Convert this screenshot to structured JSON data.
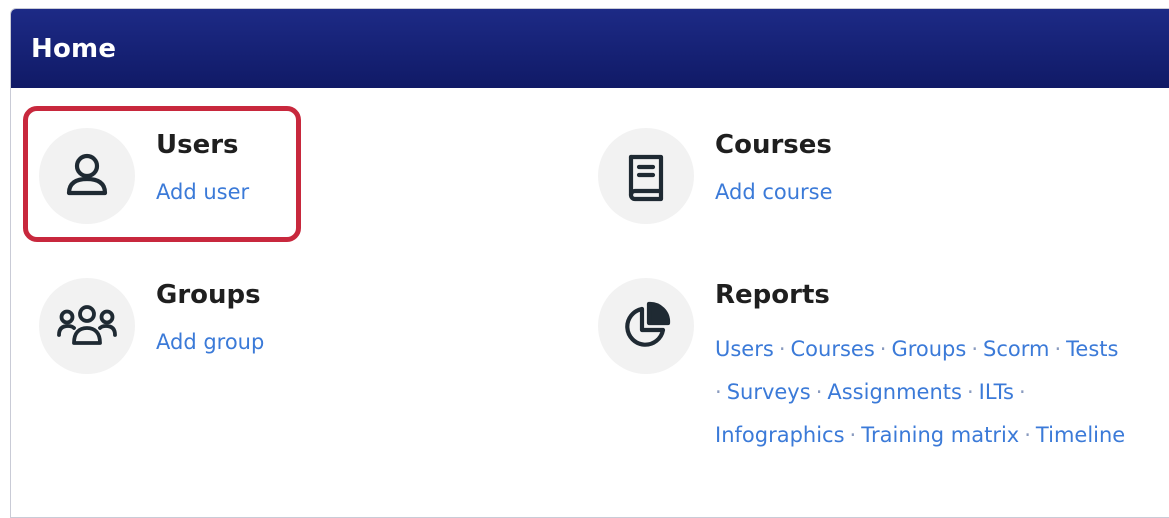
{
  "header": {
    "title": "Home"
  },
  "tiles": {
    "users": {
      "title": "Users",
      "link": "Add user",
      "icon": "user-icon"
    },
    "courses": {
      "title": "Courses",
      "link": "Add course",
      "icon": "book-icon"
    },
    "groups": {
      "title": "Groups",
      "link": "Add group",
      "icon": "group-icon"
    },
    "reports": {
      "title": "Reports",
      "icon": "pie-chart-icon",
      "links": [
        "Users",
        "Courses",
        "Groups",
        "Scorm",
        "Tests",
        "Surveys",
        "Assignments",
        "ILTs",
        "Infographics",
        "Training matrix",
        "Timeline"
      ],
      "separator": "·"
    }
  },
  "colors": {
    "header_background": "#141f72",
    "link": "#3b7ad8",
    "highlight": "#c8283d",
    "icon_circle": "#f2f2f2"
  }
}
